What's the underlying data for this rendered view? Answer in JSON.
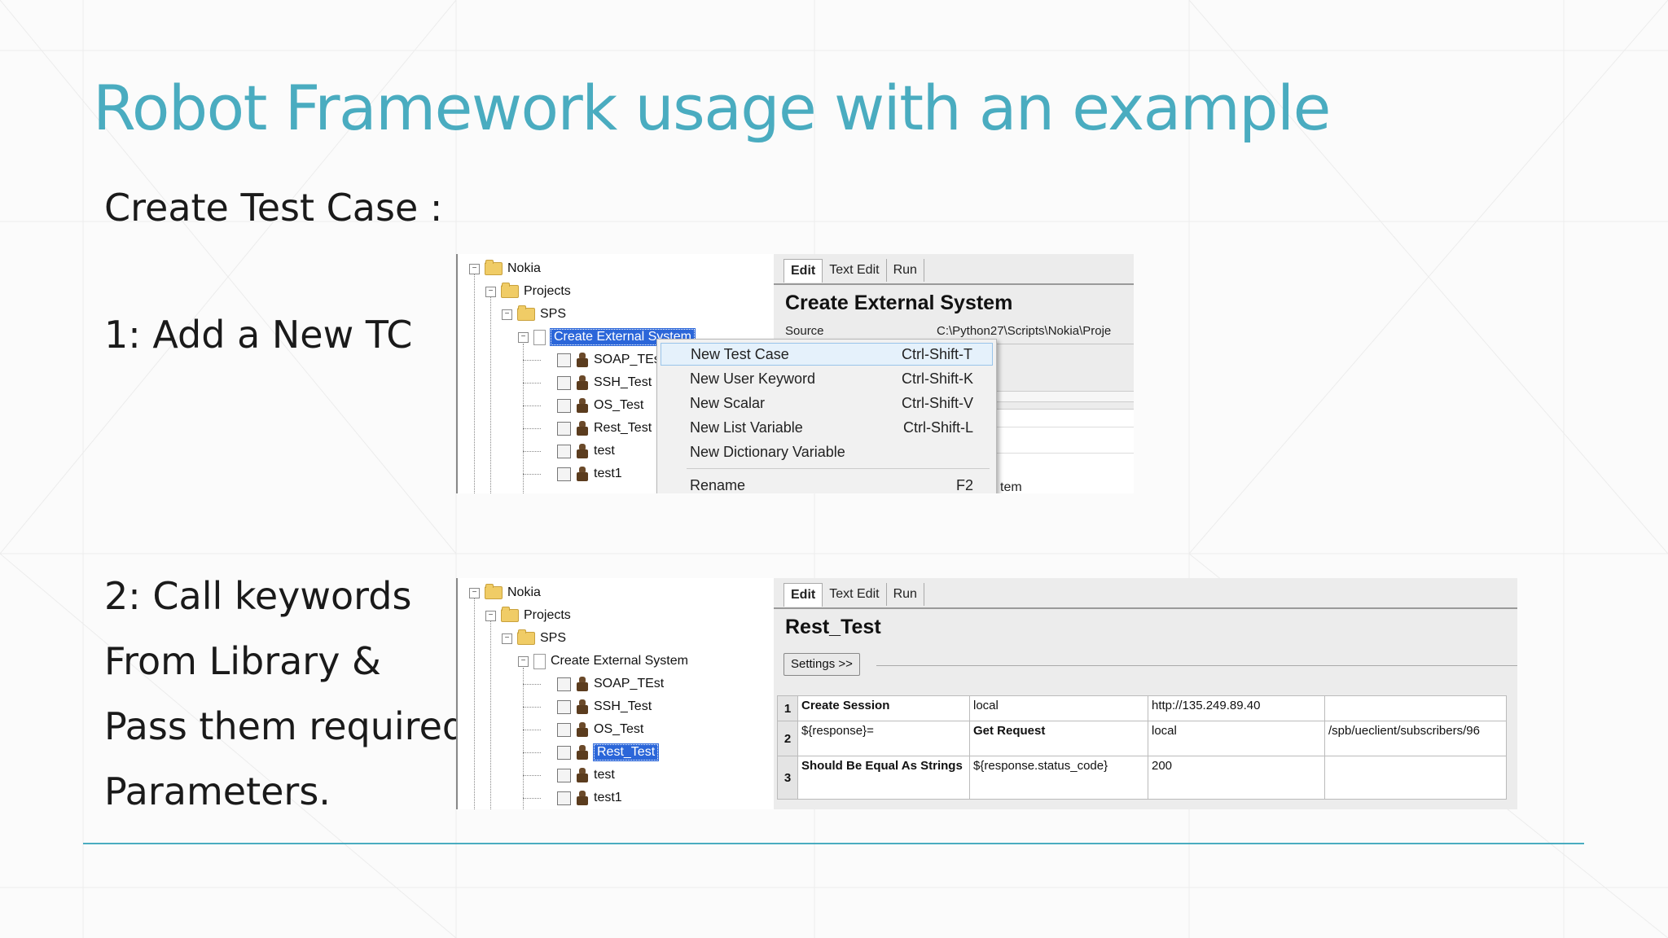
{
  "slide": {
    "title": "Robot Framework usage with an example",
    "heading": "Create Test Case :",
    "step1": "1: Add a New TC",
    "step2_lines": [
      "2: Call keywords",
      "From Library &",
      "Pass them required",
      "Parameters."
    ]
  },
  "screenshot1": {
    "tree": {
      "root": "Nokia",
      "projects": "Projects",
      "sps": "SPS",
      "suite": "Create External System",
      "tests": [
        "SOAP_TEst",
        "SSH_Test",
        "OS_Test",
        "Rest_Test",
        "test",
        "test1"
      ]
    },
    "tabs": [
      "Edit",
      "Text Edit",
      "Run"
    ],
    "editor_title": "Create External System",
    "source_label": "Source",
    "source_path": "C:\\Python27\\Scripts\\Nokia\\Proje",
    "partial_text": "tem",
    "context_menu": [
      {
        "label": "New Test Case",
        "shortcut": "Ctrl-Shift-T"
      },
      {
        "label": "New User Keyword",
        "shortcut": "Ctrl-Shift-K"
      },
      {
        "label": "New Scalar",
        "shortcut": "Ctrl-Shift-V"
      },
      {
        "label": "New List Variable",
        "shortcut": "Ctrl-Shift-L"
      },
      {
        "label": "New Dictionary Variable",
        "shortcut": ""
      },
      {
        "label": "Rename",
        "shortcut": "F2"
      }
    ]
  },
  "screenshot2": {
    "tree": {
      "root": "Nokia",
      "projects": "Projects",
      "sps": "SPS",
      "suite": "Create External System",
      "tests": [
        "SOAP_TEst",
        "SSH_Test",
        "OS_Test",
        "Rest_Test",
        "test",
        "test1"
      ]
    },
    "tabs": [
      "Edit",
      "Text Edit",
      "Run"
    ],
    "editor_title": "Rest_Test",
    "settings_button": "Settings >>",
    "rows": [
      {
        "num": "1",
        "c1": "Create Session",
        "c2": "local",
        "c3": "http://135.249.89.40",
        "c4": ""
      },
      {
        "num": "2",
        "c1": "${response}=",
        "c2": "Get Request",
        "c3": "local",
        "c4": "/spb/ueclient/subscribers/96"
      },
      {
        "num": "3",
        "c1": "Should Be Equal As Strings",
        "c2": "${response.status_code}",
        "c3": "200",
        "c4": ""
      }
    ]
  }
}
